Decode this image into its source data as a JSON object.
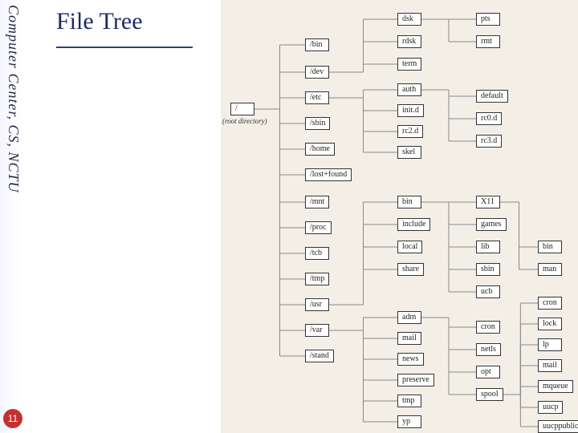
{
  "meta": {
    "side_text": "Computer Center, CS, NCTU",
    "title": "File Tree",
    "page_number": "11"
  },
  "root": {
    "label": "/",
    "caption": "(root directory)"
  },
  "level1": [
    {
      "k": "bin",
      "label": "/bin"
    },
    {
      "k": "dev",
      "label": "/dev"
    },
    {
      "k": "etc",
      "label": "/etc"
    },
    {
      "k": "sbin",
      "label": "/sbin"
    },
    {
      "k": "home",
      "label": "/home"
    },
    {
      "k": "lostfound",
      "label": "/lost+found"
    },
    {
      "k": "mnt",
      "label": "/mnt"
    },
    {
      "k": "proc",
      "label": "/proc"
    },
    {
      "k": "tcb",
      "label": "/tcb"
    },
    {
      "k": "tmp",
      "label": "/tmp"
    },
    {
      "k": "usr",
      "label": "/usr"
    },
    {
      "k": "var",
      "label": "/var"
    },
    {
      "k": "stand",
      "label": "/stand"
    }
  ],
  "dev_children": [
    {
      "k": "dsk",
      "label": "dsk"
    },
    {
      "k": "rdsk",
      "label": "rdsk"
    },
    {
      "k": "term",
      "label": "term"
    }
  ],
  "dsk_children": [
    {
      "k": "pts",
      "label": "pts"
    },
    {
      "k": "rmt",
      "label": "rmt"
    }
  ],
  "etc_children": [
    {
      "k": "auth",
      "label": "auth"
    },
    {
      "k": "initd",
      "label": "init.d"
    },
    {
      "k": "rc2d",
      "label": "rc2.d"
    },
    {
      "k": "skel",
      "label": "skel"
    }
  ],
  "auth_children": [
    {
      "k": "default",
      "label": "default"
    },
    {
      "k": "rc0d",
      "label": "rc0.d"
    },
    {
      "k": "rc3d",
      "label": "rc3.d"
    }
  ],
  "usr_children": [
    {
      "k": "ubin",
      "label": "bin"
    },
    {
      "k": "include",
      "label": "include"
    },
    {
      "k": "local",
      "label": "local"
    },
    {
      "k": "share",
      "label": "share"
    }
  ],
  "usr_r": [
    {
      "k": "x11",
      "label": "X11"
    },
    {
      "k": "games",
      "label": "games"
    },
    {
      "k": "lib",
      "label": "lib"
    },
    {
      "k": "sbin2",
      "label": "sbin"
    },
    {
      "k": "ucb",
      "label": "ucb"
    }
  ],
  "x11_children": [
    {
      "k": "xbin",
      "label": "bin"
    },
    {
      "k": "man",
      "label": "man"
    }
  ],
  "var_children": [
    {
      "k": "adm",
      "label": "adm"
    },
    {
      "k": "vmail",
      "label": "mail"
    },
    {
      "k": "news",
      "label": "news"
    },
    {
      "k": "preserve",
      "label": "preserve"
    },
    {
      "k": "vtmp",
      "label": "tmp"
    },
    {
      "k": "yp",
      "label": "yp"
    }
  ],
  "var_r": [
    {
      "k": "vcron",
      "label": "cron"
    },
    {
      "k": "netls",
      "label": "netls"
    },
    {
      "k": "opt",
      "label": "opt"
    },
    {
      "k": "spool",
      "label": "spool"
    }
  ],
  "spool_children": [
    {
      "k": "scron",
      "label": "cron"
    },
    {
      "k": "lock",
      "label": "lock"
    },
    {
      "k": "lp",
      "label": "lp"
    },
    {
      "k": "smail",
      "label": "mail"
    },
    {
      "k": "mqueue",
      "label": "mqueue"
    },
    {
      "k": "uucp",
      "label": "uucp"
    },
    {
      "k": "uucppublic",
      "label": "uucppublic"
    }
  ]
}
